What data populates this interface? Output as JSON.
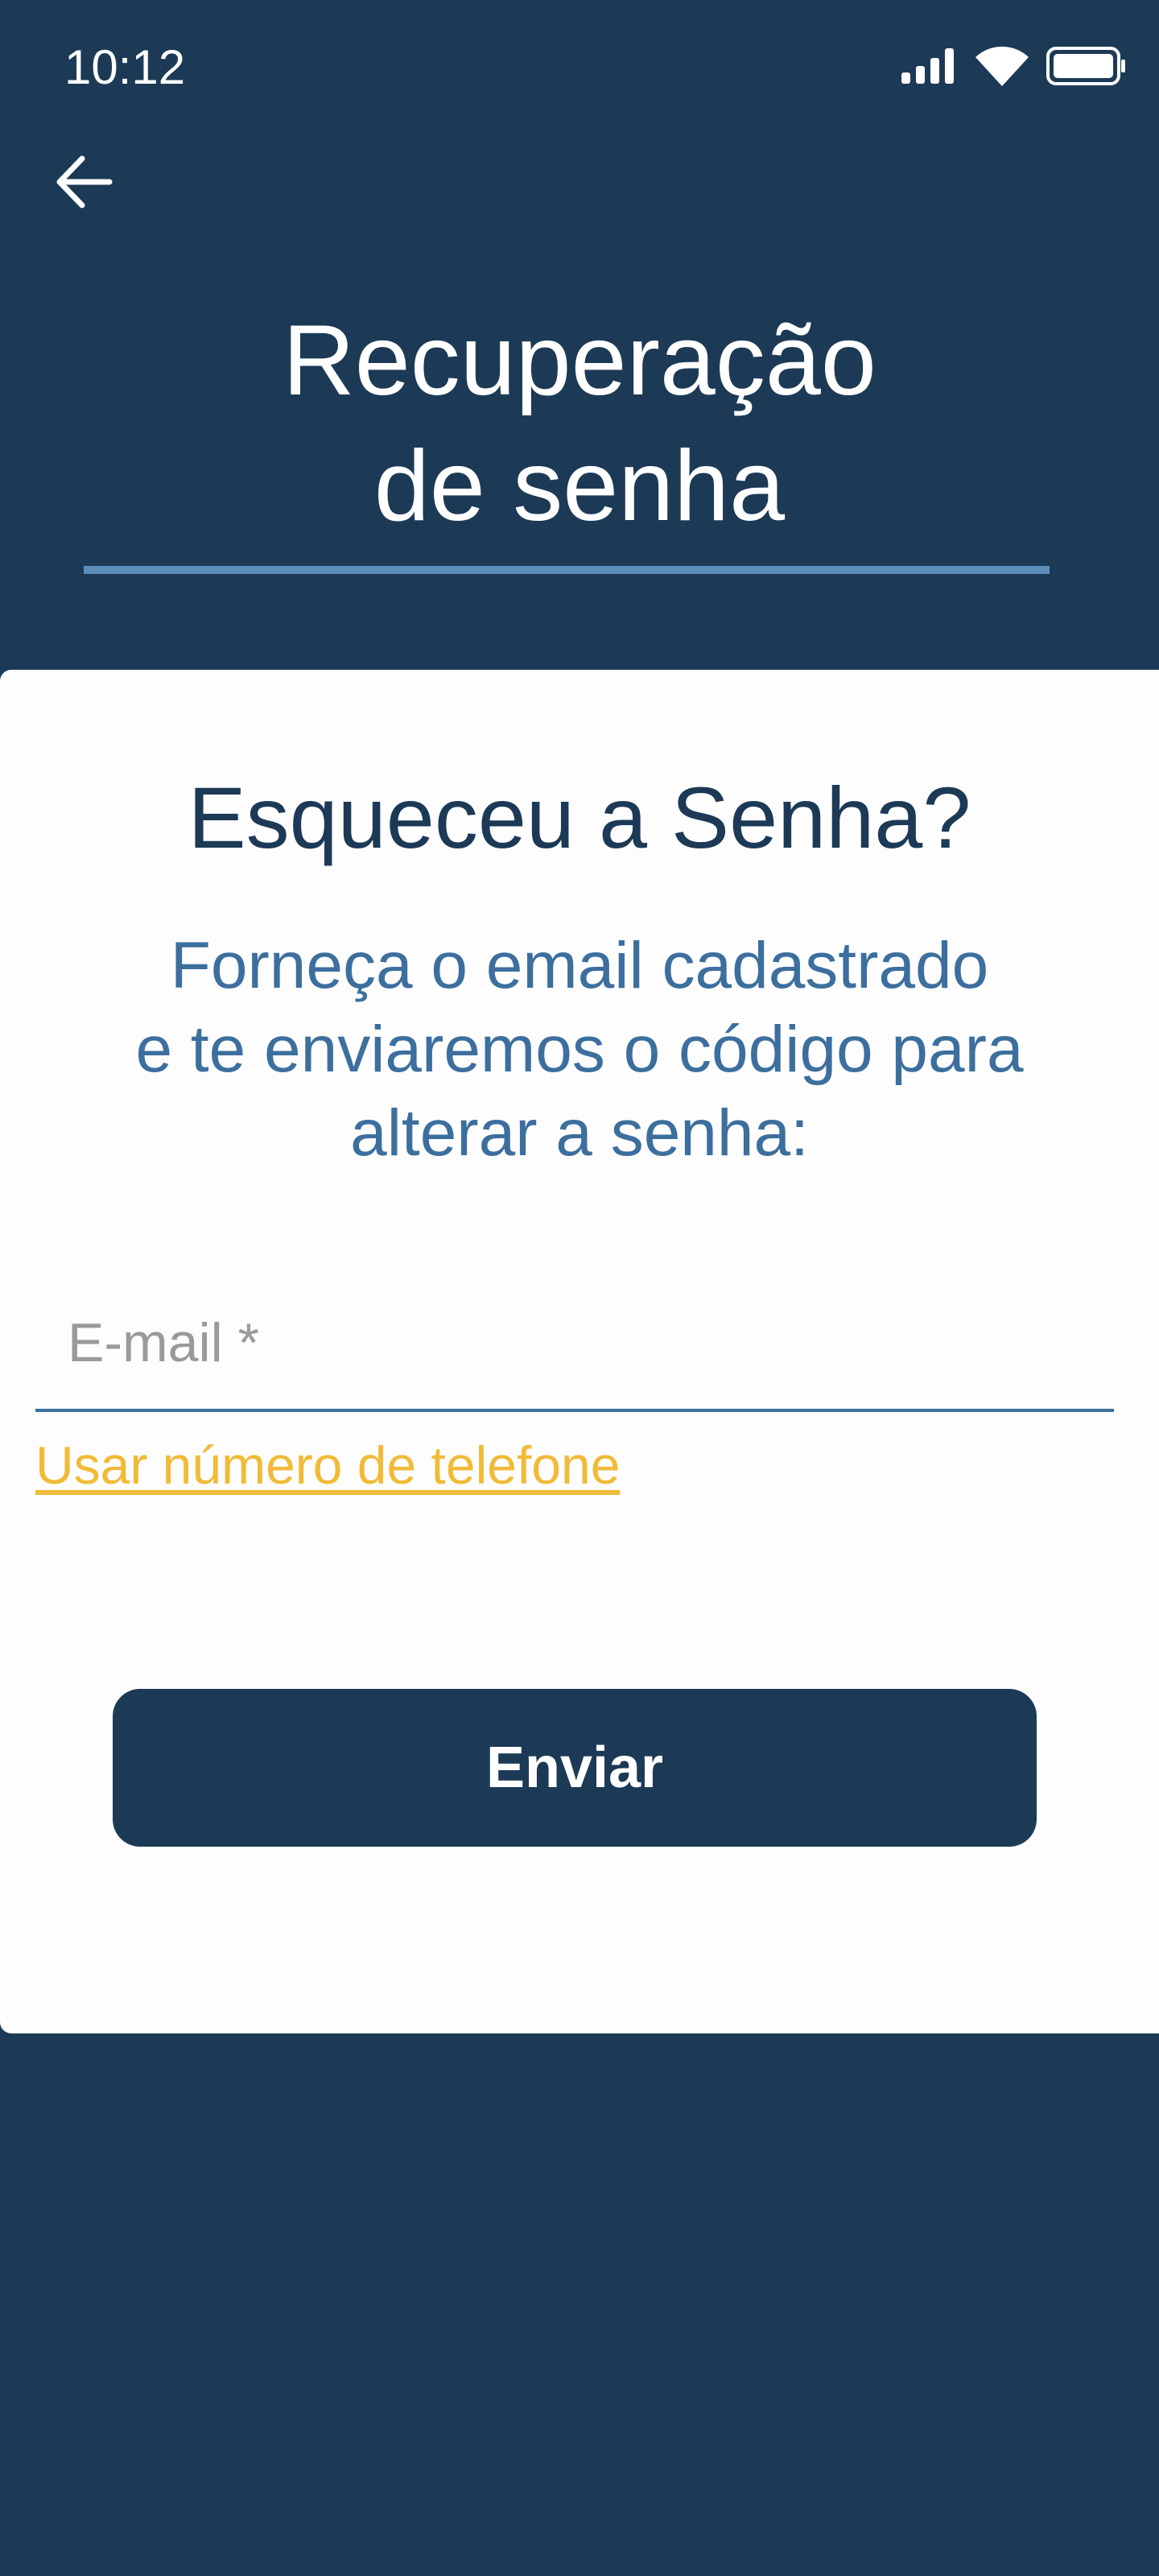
{
  "status_bar": {
    "time": "10:12",
    "icons": [
      "signal-icon",
      "wifi-icon",
      "battery-icon"
    ]
  },
  "header": {
    "back_icon": "arrow-left-icon",
    "title_line1": "Recuperação",
    "title_line2": "de senha"
  },
  "card": {
    "heading": "Esqueceu a Senha?",
    "description_line1": "Forneça o email cadastrado",
    "description_line2": "e te enviaremos o código para",
    "description_line3": "alterar a senha:",
    "email_placeholder": "E-mail *",
    "email_value": "",
    "phone_link_label": "Usar número de telefone",
    "submit_label": "Enviar"
  },
  "colors": {
    "background": "#1c3a56",
    "card": "#fdfdfd",
    "accent_blue": "#3c6f9e",
    "underline_blue": "#5b8dbb",
    "link_yellow": "#f1bb38"
  }
}
